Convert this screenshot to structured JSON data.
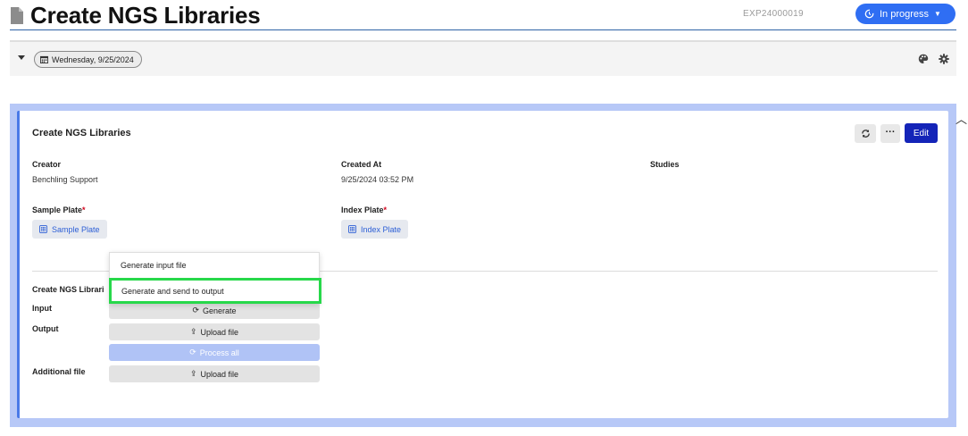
{
  "header": {
    "title": "Create NGS Libraries",
    "experiment_id": "EXP24000019",
    "status_label": "In progress"
  },
  "toolbar": {
    "date_label": "Wednesday, 9/25/2024"
  },
  "card": {
    "title": "Create NGS Libraries",
    "edit_label": "Edit",
    "more_label": "···",
    "fields": {
      "creator_label": "Creator",
      "creator_value": "Benchling Support",
      "created_at_label": "Created At",
      "created_at_value": "9/25/2024 03:52 PM",
      "studies_label": "Studies",
      "sample_plate_label": "Sample Plate",
      "sample_plate_value": "Sample Plate",
      "index_plate_label": "Index Plate",
      "index_plate_value": "Index Plate",
      "required_mark": "*"
    },
    "integration": {
      "section_label": "Create NGS Librari",
      "input_label": "Input",
      "output_label": "Output",
      "additional_label": "Additional file",
      "generate_label": "Generate",
      "upload_label": "Upload file",
      "process_all_label": "Process all",
      "upload_additional_label": "Upload file"
    }
  },
  "dropdown": {
    "items": [
      {
        "label": "Generate input file"
      },
      {
        "label": "Generate and send to output"
      }
    ]
  },
  "colors": {
    "accent": "#2f6ef3",
    "edit_button": "#1424b8",
    "highlight": "#27d84a"
  }
}
